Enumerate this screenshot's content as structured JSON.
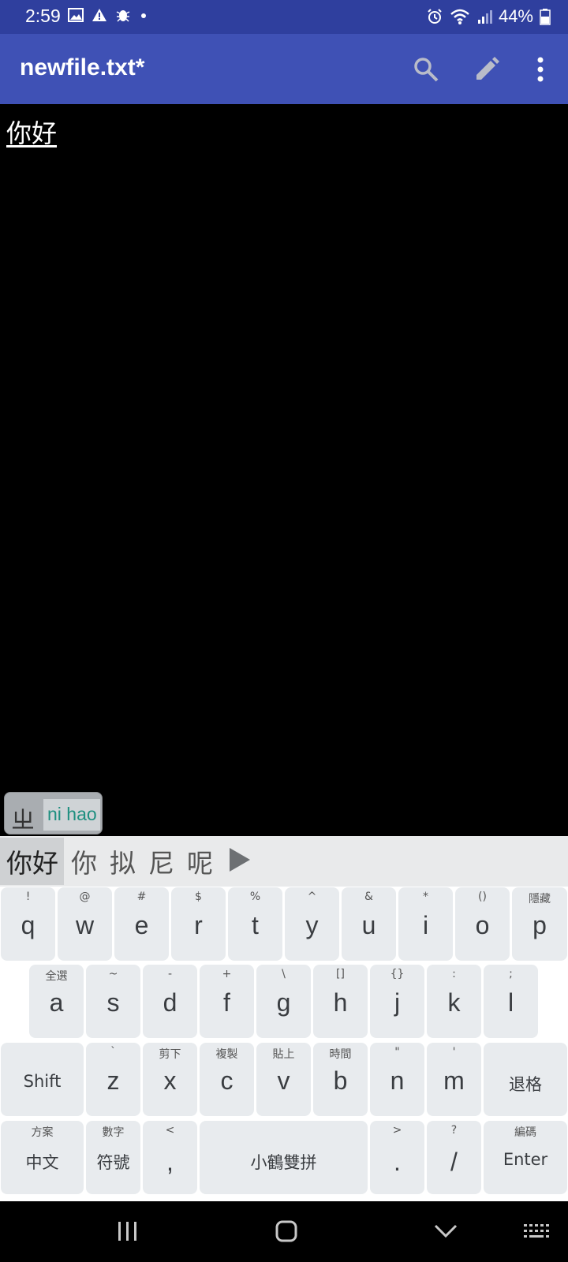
{
  "status_bar": {
    "time": "2:59",
    "battery": "44%",
    "left_icons": [
      "image-icon",
      "warning-icon",
      "bug-icon",
      "dot-icon"
    ],
    "right_icons": [
      "alarm-icon",
      "wifi-icon",
      "signal-icon",
      "battery-icon"
    ]
  },
  "app_bar": {
    "title": "newfile.txt*",
    "actions": [
      "search-icon",
      "edit-pencil-icon",
      "more-vert-icon"
    ],
    "background": "#3f51b5",
    "status_background": "#2f3f9e"
  },
  "editor": {
    "text": "你好"
  },
  "composing": {
    "key_symbol": "ㄓ",
    "pinyin": "ni hao",
    "pinyin_color": "#1e8f80"
  },
  "candidates": {
    "selected": "你好",
    "items": [
      "你",
      "拟",
      "尼",
      "呢"
    ],
    "more": "more-arrow-icon"
  },
  "keyboard": {
    "row1": [
      {
        "hint": "!",
        "main": "q"
      },
      {
        "hint": "@",
        "main": "w"
      },
      {
        "hint": "#",
        "main": "e"
      },
      {
        "hint": "$",
        "main": "r"
      },
      {
        "hint": "%",
        "main": "t"
      },
      {
        "hint": "^",
        "main": "y"
      },
      {
        "hint": "&",
        "main": "u"
      },
      {
        "hint": "*",
        "main": "i"
      },
      {
        "hint": "()",
        "main": "o"
      },
      {
        "hint": "隱藏",
        "main": "p"
      }
    ],
    "row2": [
      {
        "hint": "全選",
        "main": "a"
      },
      {
        "hint": "~",
        "main": "s"
      },
      {
        "hint": "-",
        "main": "d"
      },
      {
        "hint": "+",
        "main": "f"
      },
      {
        "hint": "\\",
        "main": "g"
      },
      {
        "hint": "[]",
        "main": "h"
      },
      {
        "hint": "{}",
        "main": "j"
      },
      {
        "hint": ":",
        "main": "k"
      },
      {
        "hint": ";",
        "main": "l"
      }
    ],
    "row3": {
      "shift": "Shift",
      "letters": [
        {
          "hint": "`",
          "main": "z"
        },
        {
          "hint": "剪下",
          "main": "x"
        },
        {
          "hint": "複製",
          "main": "c"
        },
        {
          "hint": "貼上",
          "main": "v"
        },
        {
          "hint": "時間",
          "main": "b"
        },
        {
          "hint": "\"",
          "main": "n"
        },
        {
          "hint": "'",
          "main": "m"
        }
      ],
      "backspace": "退格"
    },
    "row4": {
      "lang": {
        "hint": "方案",
        "label": "中文"
      },
      "symbols": {
        "hint": "數字",
        "label": "符號"
      },
      "comma": {
        "hint": "<",
        "main": ","
      },
      "space": "小鶴雙拼",
      "period": {
        "hint": ">",
        "main": "."
      },
      "slash": {
        "hint": "?",
        "main": "/"
      },
      "enter": {
        "hint": "編碼",
        "label": "Enter"
      }
    }
  },
  "nav_bar": {
    "buttons": [
      "recents-icon",
      "home-icon",
      "back-chevron-icon",
      "keyboard-switch-icon"
    ]
  }
}
